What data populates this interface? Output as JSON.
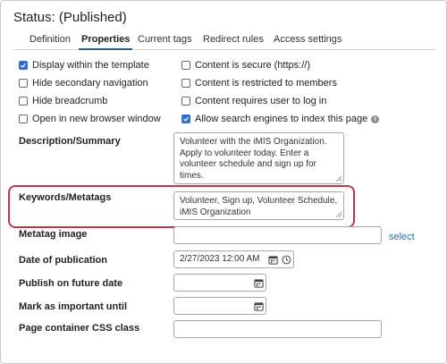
{
  "header": {
    "title": "Status: (Published)"
  },
  "tabs": [
    {
      "label": "Definition"
    },
    {
      "label": "Properties"
    },
    {
      "label": "Current tags"
    },
    {
      "label": "Redirect rules"
    },
    {
      "label": "Access settings"
    }
  ],
  "active_tab": "Properties",
  "options": {
    "left": [
      {
        "label": "Display within the template",
        "checked": true
      },
      {
        "label": "Hide secondary navigation",
        "checked": false
      },
      {
        "label": "Hide breadcrumb",
        "checked": false
      },
      {
        "label": "Open in new browser window",
        "checked": false
      }
    ],
    "right": [
      {
        "label": "Content is secure (https://)",
        "checked": false
      },
      {
        "label": "Content is restricted to members",
        "checked": false
      },
      {
        "label": "Content requires user to log in",
        "checked": false
      },
      {
        "label": "Allow search engines to index this page",
        "checked": true
      }
    ]
  },
  "fields": {
    "description": {
      "label": "Description/Summary",
      "value": "Volunteer with the iMIS Organization. Apply to volunteer today. Enter a volunteer schedule and sign up for times."
    },
    "keywords": {
      "label": "Keywords/Metatags",
      "value": "Volunteer, Sign up, Volunteer Schedule, iMIS Organization"
    },
    "metatag_image": {
      "label": "Metatag image",
      "value": "",
      "select_label": "select"
    },
    "date_of_publication": {
      "label": "Date of publication",
      "value": "2/27/2023 12:00 AM"
    },
    "publish_future": {
      "label": "Publish on future date",
      "value": ""
    },
    "mark_important": {
      "label": "Mark as important until",
      "value": ""
    },
    "css_class": {
      "label": "Page container CSS class",
      "value": ""
    }
  },
  "colors": {
    "accent": "#2f6fd1",
    "highlight": "#c0394a",
    "link": "#2a6db0"
  }
}
